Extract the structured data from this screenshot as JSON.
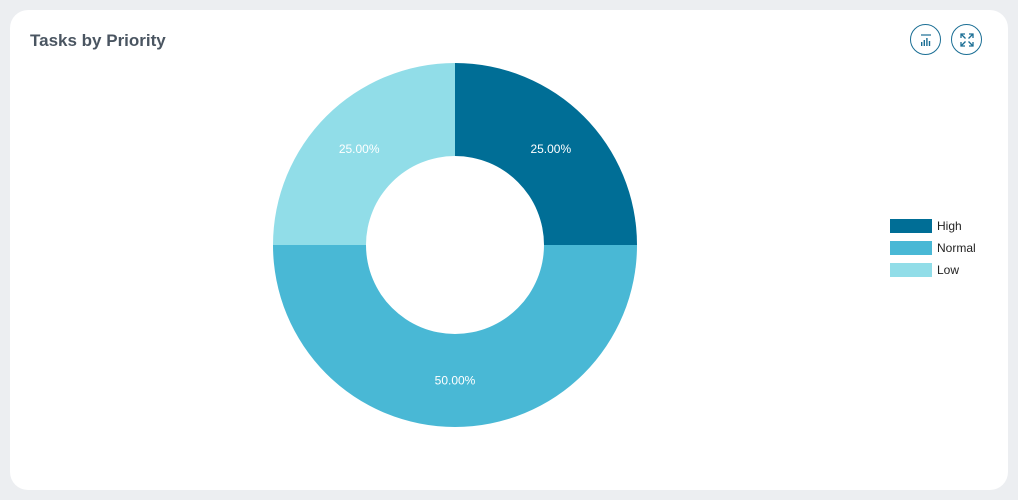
{
  "card": {
    "title": "Tasks by Priority"
  },
  "toolbar": {
    "chart_icon": "bar-chart-icon",
    "expand_icon": "expand-icon"
  },
  "chart_data": {
    "type": "pie",
    "variant": "donut",
    "title": "Tasks by Priority",
    "categories": [
      "High",
      "Normal",
      "Low"
    ],
    "values": [
      25,
      50,
      25
    ],
    "labels": [
      "25.00%",
      "50.00%",
      "25.00%"
    ],
    "colors": [
      "#006e96",
      "#49b8d5",
      "#91dde8"
    ],
    "legend_position": "right"
  }
}
